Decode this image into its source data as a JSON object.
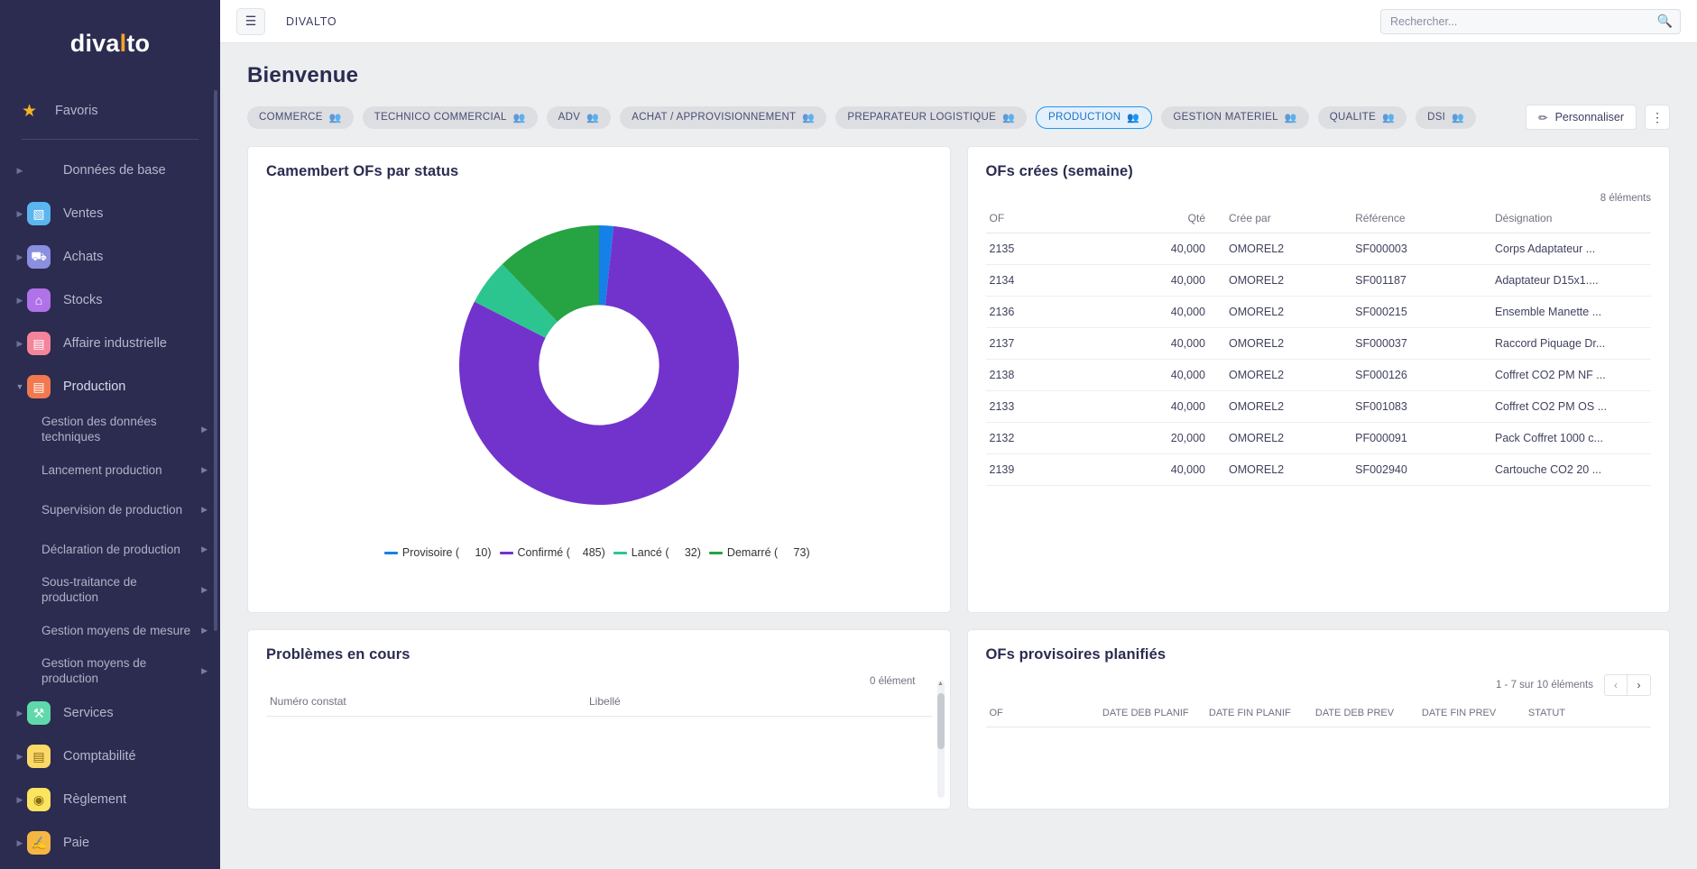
{
  "brand": {
    "pre": "diva",
    "accent": "l",
    "post": "to"
  },
  "sidebar": {
    "favoris": "Favoris",
    "items": [
      {
        "label": "Données de base",
        "icon": "",
        "color": "",
        "has_icon": false
      },
      {
        "label": "Ventes",
        "icon": "chart-icon",
        "color": "#5bb5ef",
        "has_icon": true
      },
      {
        "label": "Achats",
        "icon": "cart-icon",
        "color": "#8a8fe0",
        "has_icon": true
      },
      {
        "label": "Stocks",
        "icon": "warehouse-icon",
        "color": "#b072e8",
        "has_icon": true
      },
      {
        "label": "Affaire industrielle",
        "icon": "factory-icon",
        "color": "#f4849a",
        "has_icon": true
      },
      {
        "label": "Production",
        "icon": "factory-icon",
        "color": "#f2794f",
        "has_icon": true
      }
    ],
    "production_sub": [
      "Gestion des données techniques",
      "Lancement production",
      "Supervision de production",
      "Déclaration de production",
      "Sous-traitance de production",
      "Gestion moyens de mesure",
      "Gestion moyens de production"
    ],
    "items_after": [
      {
        "label": "Services",
        "icon": "wrench-icon",
        "color": "#5fd9ab"
      },
      {
        "label": "Comptabilité",
        "icon": "book-icon",
        "color": "#fcd966"
      },
      {
        "label": "Règlement",
        "icon": "moneybag-icon",
        "color": "#fbe45f"
      },
      {
        "label": "Paie",
        "icon": "hand-coin-icon",
        "color": "#f5b642"
      }
    ]
  },
  "topbar": {
    "app_name": "DIVALTO",
    "menu_icon": "hamburger-icon",
    "search_placeholder": "Rechercher...",
    "search_value": "",
    "search_icon": "search-icon"
  },
  "page": {
    "title": "Bienvenue",
    "tabs": [
      {
        "label": "COMMERCE",
        "active": false
      },
      {
        "label": "TECHNICO COMMERCIAL",
        "active": false
      },
      {
        "label": "ADV",
        "active": false
      },
      {
        "label": "ACHAT / APPROVISIONNEMENT",
        "active": false
      },
      {
        "label": "PREPARATEUR LOGISTIQUE",
        "active": false
      },
      {
        "label": "PRODUCTION",
        "active": true
      },
      {
        "label": "GESTION MATERIEL",
        "active": false
      },
      {
        "label": "QUALITE",
        "active": false
      },
      {
        "label": "DSI",
        "active": false
      }
    ],
    "customize_label": "Personnaliser",
    "customize_icon": "pencil-icon",
    "kebab_icon": "more-vertical-icon"
  },
  "chart_data": {
    "type": "pie",
    "title": "Camembert OFs par status",
    "donut": true,
    "categories": [
      "Provisoire",
      "Confirmé",
      "Lancé",
      "Demarré"
    ],
    "values": [
      10,
      485,
      32,
      73
    ],
    "colors": [
      "#1580e8",
      "#7233cc",
      "#2dc58f",
      "#26a343"
    ],
    "legend_position": "bottom",
    "legend_labels": [
      "Provisoire (     10)",
      "Confirmé (    485)",
      "Lancé (     32)",
      "Demarré (     73)"
    ]
  },
  "ofs_crees": {
    "title": "OFs crées (semaine)",
    "count_label": "8 éléments",
    "columns": [
      "OF",
      "Qté",
      "Crée par",
      "Référence",
      "Désignation"
    ],
    "rows": [
      [
        "2135",
        "40,000",
        "OMOREL2",
        "SF000003",
        "Corps Adaptateur ..."
      ],
      [
        "2134",
        "40,000",
        "OMOREL2",
        "SF001187",
        "Adaptateur D15x1...."
      ],
      [
        "2136",
        "40,000",
        "OMOREL2",
        "SF000215",
        "Ensemble Manette ..."
      ],
      [
        "2137",
        "40,000",
        "OMOREL2",
        "SF000037",
        "Raccord Piquage Dr..."
      ],
      [
        "2138",
        "40,000",
        "OMOREL2",
        "SF000126",
        "Coffret CO2 PM NF ..."
      ],
      [
        "2133",
        "40,000",
        "OMOREL2",
        "SF001083",
        "Coffret CO2 PM OS ..."
      ],
      [
        "2132",
        "20,000",
        "OMOREL2",
        "PF000091",
        "Pack Coffret 1000 c..."
      ],
      [
        "2139",
        "40,000",
        "OMOREL2",
        "SF002940",
        "Cartouche CO2 20 ..."
      ]
    ]
  },
  "problemes": {
    "title": "Problèmes en cours",
    "count_label": "0 élément",
    "columns": [
      "Numéro constat",
      "Libellé"
    ]
  },
  "ofs_provisoires": {
    "title": "OFs provisoires planifiés",
    "pagination_label": "1 - 7 sur 10 éléments",
    "prev_icon": "chevron-left-icon",
    "next_icon": "chevron-right-icon",
    "columns": [
      "OF",
      "DATE DEB PLANIF",
      "DATE FIN PLANIF",
      "DATE DEB PREV",
      "DATE FIN PREV",
      "STATUT"
    ]
  }
}
